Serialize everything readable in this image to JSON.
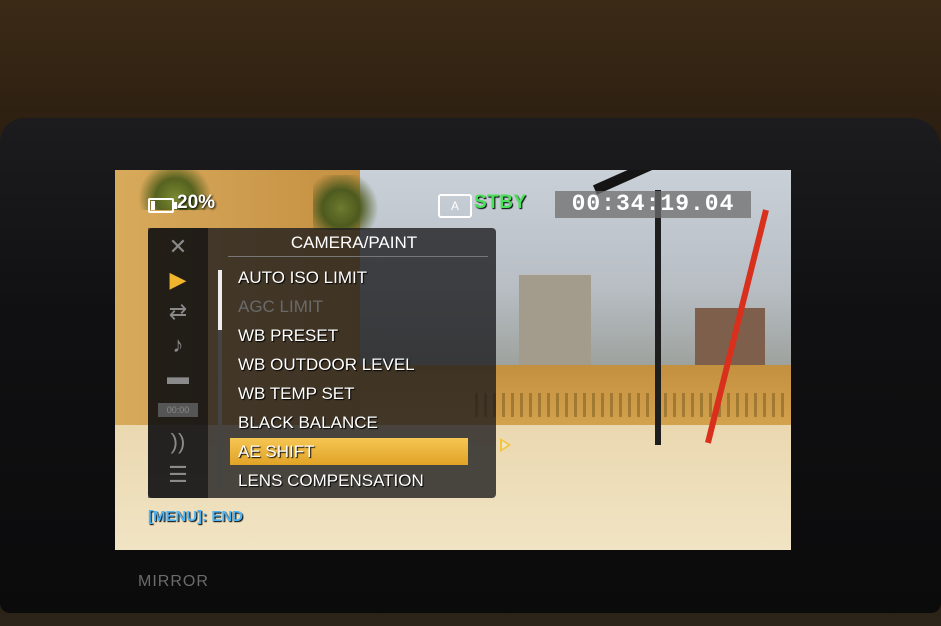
{
  "status": {
    "battery_percent": "20%",
    "battery_level": 0.2,
    "record_state": "STBY",
    "timecode": "00:34:19.04",
    "record_state_color": "#4be05a"
  },
  "menu": {
    "title": "CAMERA/PAINT",
    "side_icons": [
      {
        "name": "close-icon",
        "glyph": "✕",
        "active": false
      },
      {
        "name": "camera-icon",
        "glyph": "▶",
        "active": true
      },
      {
        "name": "swap-icon",
        "glyph": "⇄",
        "active": false
      },
      {
        "name": "audio-note-icon",
        "glyph": "♪",
        "active": false
      },
      {
        "name": "display-icon",
        "glyph": "▬",
        "active": false
      },
      {
        "name": "timecode-icon",
        "glyph": "00:00",
        "active": false
      },
      {
        "name": "wireless-icon",
        "glyph": "))",
        "active": false
      },
      {
        "name": "list-icon",
        "glyph": "☰",
        "active": false
      }
    ],
    "items": [
      {
        "label": "AUTO ISO LIMIT",
        "state": "normal"
      },
      {
        "label": "AGC LIMIT",
        "state": "disabled"
      },
      {
        "label": "WB PRESET",
        "state": "normal"
      },
      {
        "label": "WB OUTDOOR LEVEL",
        "state": "normal"
      },
      {
        "label": "WB TEMP SET",
        "state": "normal"
      },
      {
        "label": "BLACK BALANCE",
        "state": "normal"
      },
      {
        "label": "AE SHIFT",
        "state": "selected"
      },
      {
        "label": "LENS COMPENSATION",
        "state": "normal"
      }
    ],
    "footer": "[MENU]: END",
    "highlight_color": "#f0b52c"
  },
  "bezel": {
    "label": "MIRROR"
  }
}
